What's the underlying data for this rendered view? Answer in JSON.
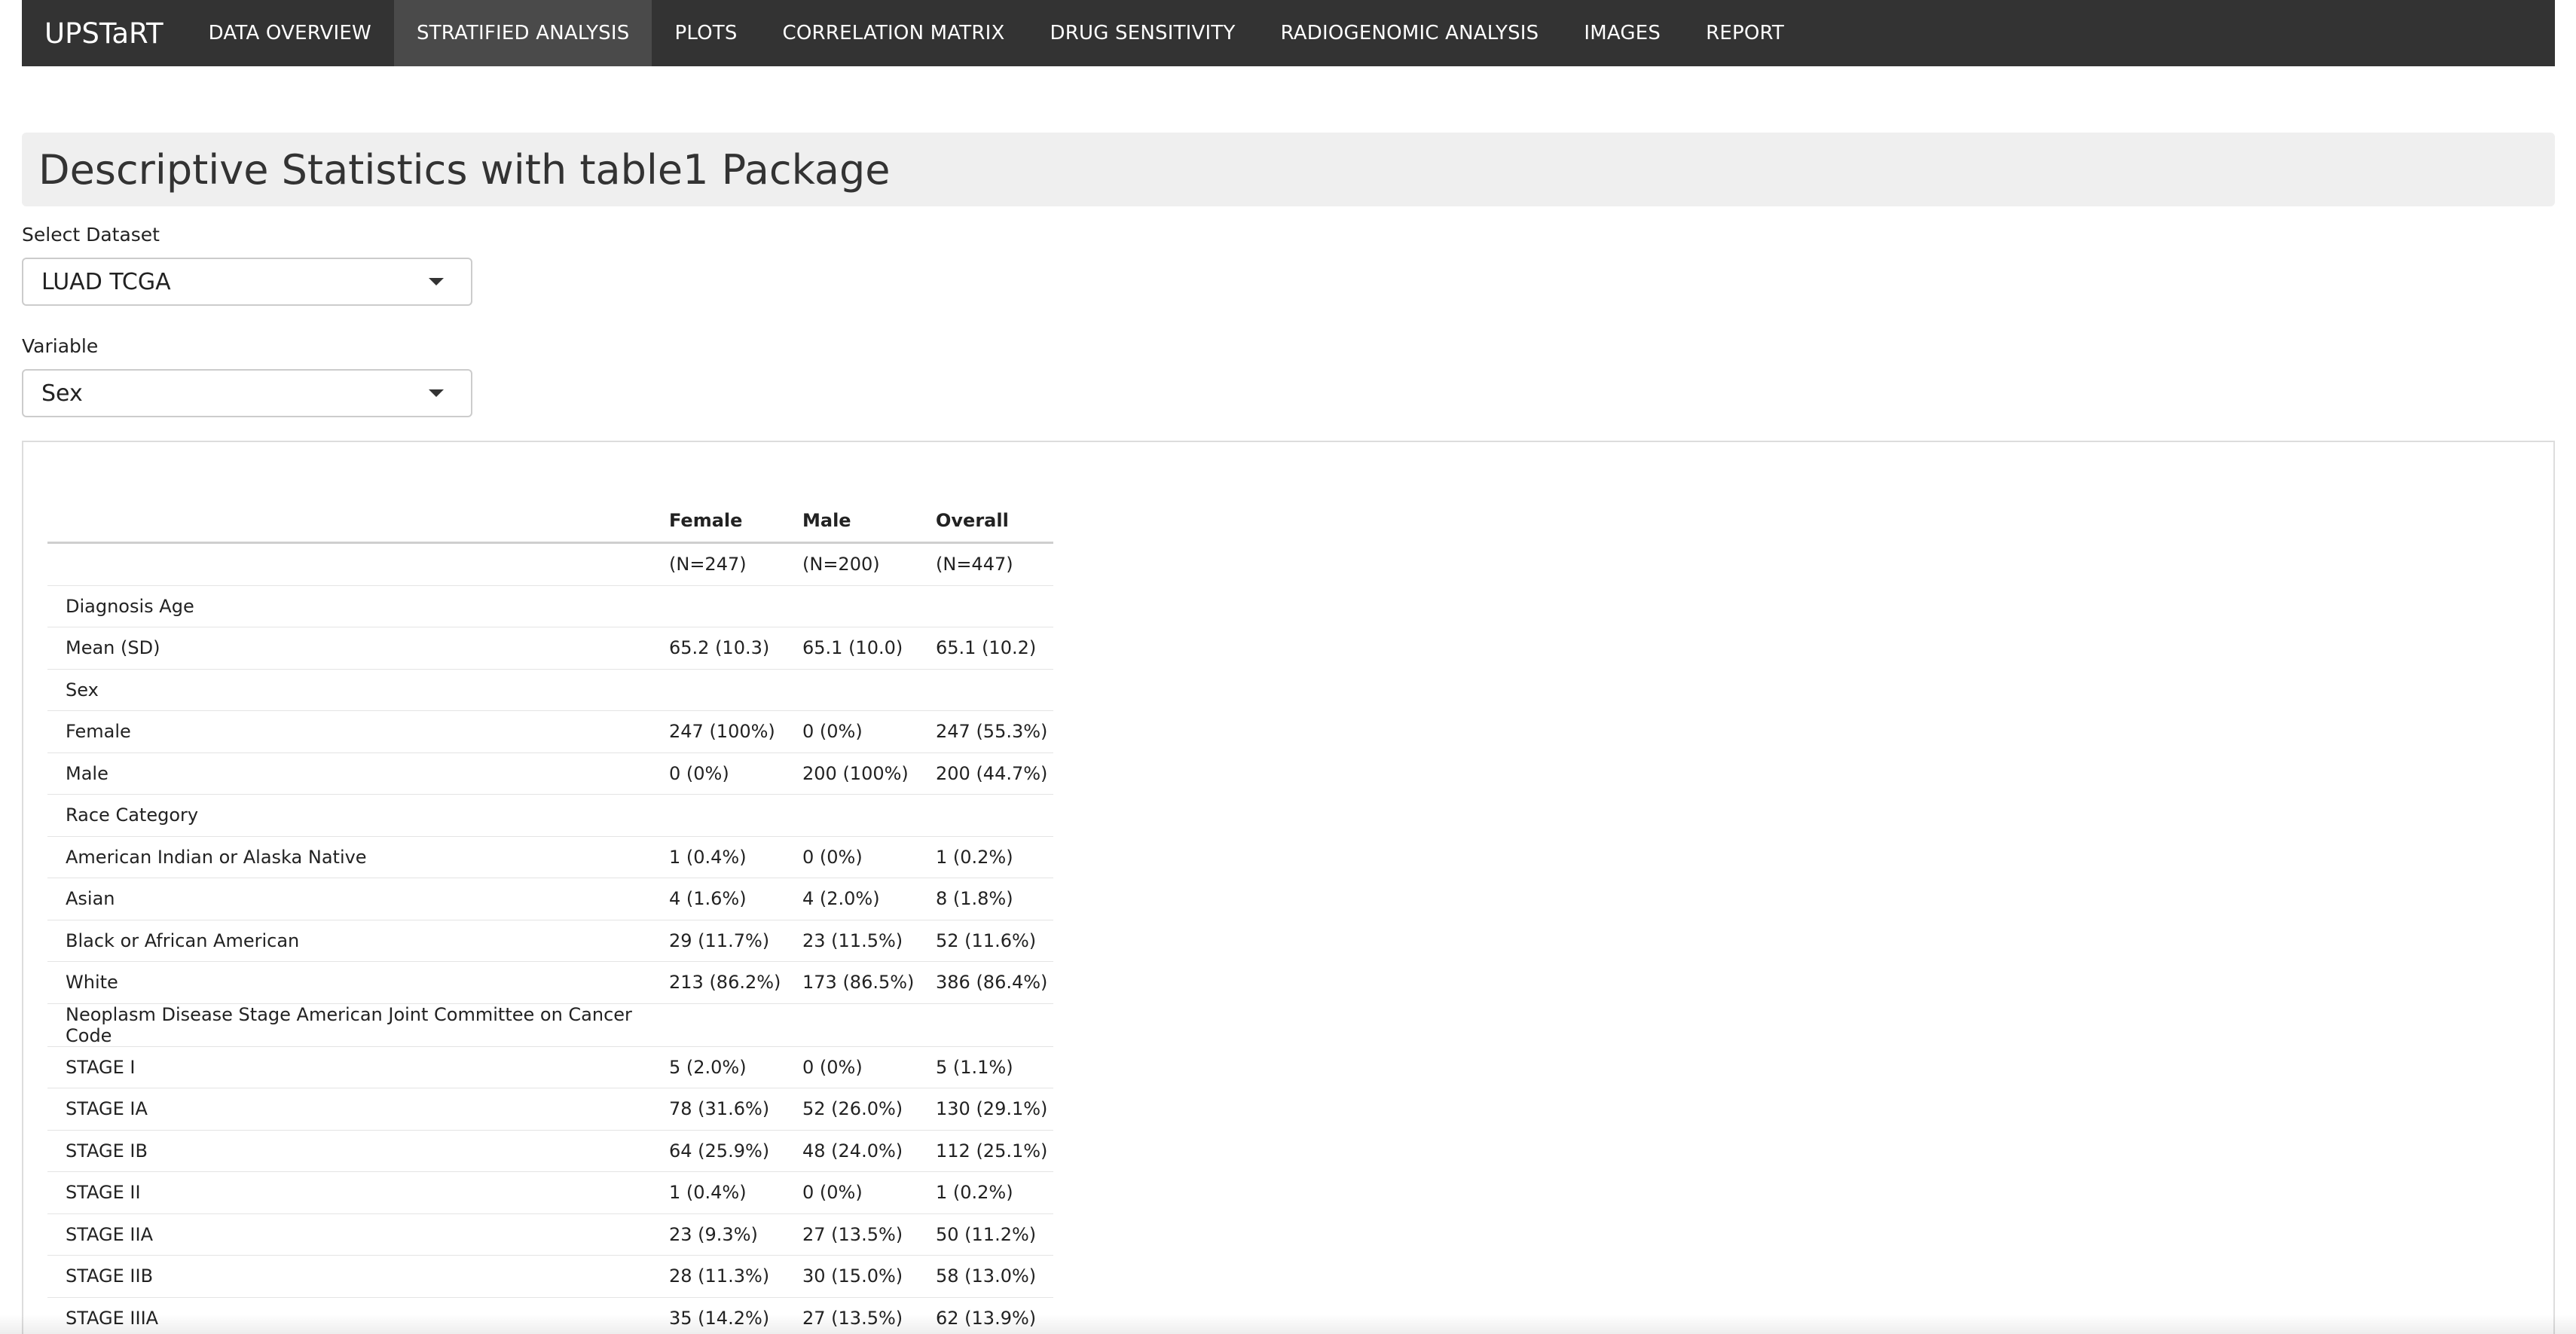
{
  "navbar": {
    "brand": "UPSTaRT",
    "items": [
      {
        "label": "DATA OVERVIEW"
      },
      {
        "label": "STRATIFIED ANALYSIS"
      },
      {
        "label": "PLOTS"
      },
      {
        "label": "CORRELATION MATRIX"
      },
      {
        "label": "DRUG SENSITIVITY"
      },
      {
        "label": "RADIOGENOMIC ANALYSIS"
      },
      {
        "label": "IMAGES"
      },
      {
        "label": "REPORT"
      }
    ],
    "active_index": 1
  },
  "page": {
    "title": "Descriptive Statistics with table1 Package"
  },
  "controls": {
    "dataset_label": "Select Dataset",
    "dataset_value": "LUAD TCGA",
    "variable_label": "Variable",
    "variable_value": "Sex"
  },
  "table": {
    "headers": [
      "",
      "Female",
      "Male",
      "Overall"
    ],
    "counts": [
      "",
      "(N=247)",
      "(N=200)",
      "(N=447)"
    ],
    "rows": [
      {
        "label": "Diagnosis Age",
        "female": "",
        "male": "",
        "overall": ""
      },
      {
        "label": "Mean (SD)",
        "female": "65.2 (10.3)",
        "male": "65.1 (10.0)",
        "overall": "65.1 (10.2)"
      },
      {
        "label": "Sex",
        "female": "",
        "male": "",
        "overall": ""
      },
      {
        "label": "Female",
        "female": "247 (100%)",
        "male": "0 (0%)",
        "overall": "247 (55.3%)"
      },
      {
        "label": "Male",
        "female": "0 (0%)",
        "male": "200 (100%)",
        "overall": "200 (44.7%)"
      },
      {
        "label": "Race Category",
        "female": "",
        "male": "",
        "overall": ""
      },
      {
        "label": "American Indian or Alaska Native",
        "female": "1 (0.4%)",
        "male": "0 (0%)",
        "overall": "1 (0.2%)"
      },
      {
        "label": "Asian",
        "female": "4 (1.6%)",
        "male": "4 (2.0%)",
        "overall": "8 (1.8%)"
      },
      {
        "label": "Black or African American",
        "female": "29 (11.7%)",
        "male": "23 (11.5%)",
        "overall": "52 (11.6%)"
      },
      {
        "label": "White",
        "female": "213 (86.2%)",
        "male": "173 (86.5%)",
        "overall": "386 (86.4%)"
      },
      {
        "label": "Neoplasm Disease Stage American Joint Committee on Cancer Code",
        "female": "",
        "male": "",
        "overall": ""
      },
      {
        "label": "STAGE I",
        "female": "5 (2.0%)",
        "male": "0 (0%)",
        "overall": "5 (1.1%)"
      },
      {
        "label": "STAGE IA",
        "female": "78 (31.6%)",
        "male": "52 (26.0%)",
        "overall": "130 (29.1%)"
      },
      {
        "label": "STAGE IB",
        "female": "64 (25.9%)",
        "male": "48 (24.0%)",
        "overall": "112 (25.1%)"
      },
      {
        "label": "STAGE II",
        "female": "1 (0.4%)",
        "male": "0 (0%)",
        "overall": "1 (0.2%)"
      },
      {
        "label": "STAGE IIA",
        "female": "23 (9.3%)",
        "male": "27 (13.5%)",
        "overall": "50 (11.2%)"
      },
      {
        "label": "STAGE IIB",
        "female": "28 (11.3%)",
        "male": "30 (15.0%)",
        "overall": "58 (13.0%)"
      },
      {
        "label": "STAGE IIIA",
        "female": "35 (14.2%)",
        "male": "27 (13.5%)",
        "overall": "62 (13.9%)"
      }
    ]
  }
}
